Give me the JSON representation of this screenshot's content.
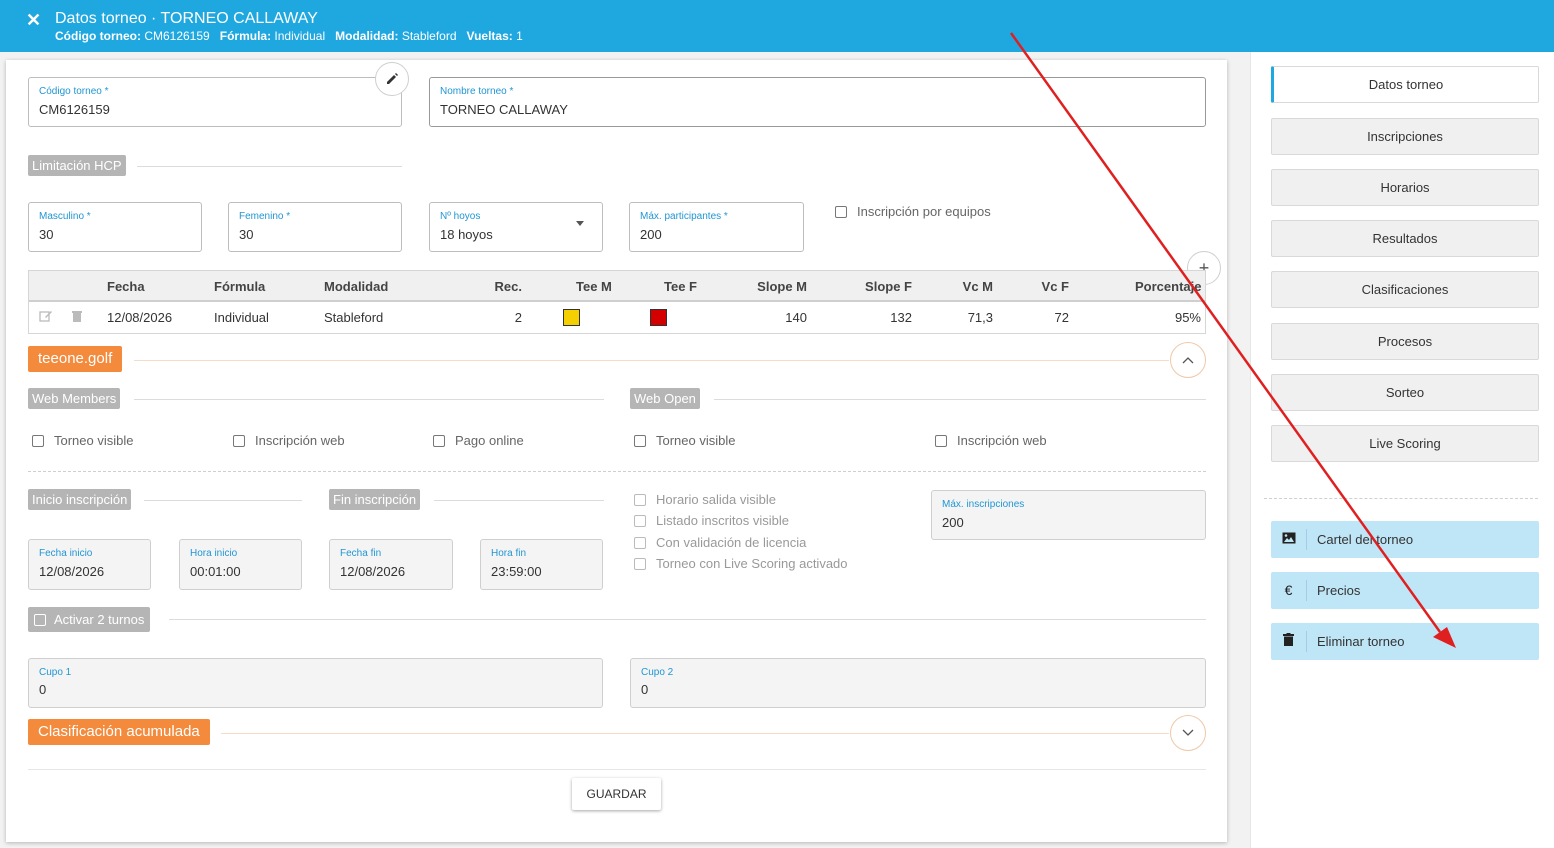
{
  "header": {
    "title": "Datos torneo · TORNEO CALLAWAY",
    "codigo_label": "Código torneo:",
    "codigo_value": "CM6126159",
    "formula_label": "Fórmula:",
    "formula_value": "Individual",
    "modalidad_label": "Modalidad:",
    "modalidad_value": "Stableford",
    "vueltas_label": "Vueltas:",
    "vueltas_value": "1",
    "close_icon": "✕"
  },
  "form": {
    "codigo": {
      "label": "Código torneo *",
      "value": "CM6126159"
    },
    "nombre": {
      "label": "Nombre torneo *",
      "value": "TORNEO CALLAWAY"
    },
    "limitacion_hcp": "Limitación HCP",
    "masculino": {
      "label": "Masculino *",
      "value": "30"
    },
    "femenino": {
      "label": "Femenino *",
      "value": "30"
    },
    "hoyos": {
      "label": "Nº hoyos",
      "value": "18 hoyos"
    },
    "max_participantes": {
      "label": "Máx. participantes *",
      "value": "200"
    },
    "inscripcion_equipos": "Inscripción por equipos"
  },
  "table": {
    "headers": [
      "Fecha",
      "Fórmula",
      "Modalidad",
      "Rec.",
      "Tee M",
      "Tee F",
      "Slope M",
      "Slope F",
      "Vc M",
      "Vc F",
      "Porcentaje"
    ],
    "row": {
      "fecha": "12/08/2026",
      "formula": "Individual",
      "modalidad": "Stableford",
      "rec": "2",
      "tee_m_color": "#f5d000",
      "tee_f_color": "#d40000",
      "slope_m": "140",
      "slope_f": "132",
      "vc_m": "71,3",
      "vc_f": "72",
      "porcentaje": "95%"
    }
  },
  "teeone": {
    "title": "teeone.golf",
    "web_members": "Web Members",
    "web_open": "Web Open",
    "members_checks": [
      "Torneo visible",
      "Inscripción web",
      "Pago online"
    ],
    "open_checks": [
      "Torneo visible",
      "Inscripción web"
    ],
    "inicio_inscripcion": "Inicio inscripción",
    "fin_inscripcion": "Fin inscripción",
    "fecha_inicio": {
      "label": "Fecha inicio",
      "value": "12/08/2026"
    },
    "hora_inicio": {
      "label": "Hora inicio",
      "value": "00:01:00"
    },
    "fecha_fin": {
      "label": "Fecha fin",
      "value": "12/08/2026"
    },
    "hora_fin": {
      "label": "Hora fin",
      "value": "23:59:00"
    },
    "open_extra_checks": [
      "Horario salida visible",
      "Listado inscritos visible",
      "Con validación de licencia",
      "Torneo con Live Scoring activado"
    ],
    "max_inscripciones": {
      "label": "Máx. inscripciones",
      "value": "200"
    },
    "activar_turnos": "Activar 2 turnos",
    "cupo1": {
      "label": "Cupo 1",
      "value": "0"
    },
    "cupo2": {
      "label": "Cupo 2",
      "value": "0"
    }
  },
  "clasificacion": {
    "title": "Clasificación acumulada"
  },
  "save_label": "GUARDAR",
  "sidebar": {
    "nav": [
      "Datos torneo",
      "Inscripciones",
      "Horarios",
      "Resultados",
      "Clasificaciones",
      "Procesos",
      "Sorteo",
      "Live Scoring"
    ],
    "actions": [
      {
        "label": "Cartel del torneo",
        "icon": "image-icon"
      },
      {
        "label": "Precios",
        "icon": "euro-icon"
      },
      {
        "label": "Eliminar torneo",
        "icon": "trash-icon"
      }
    ]
  },
  "colors": {
    "header": "#1fa7e0",
    "accent_orange": "#f38a3c",
    "action_blue": "#bfe6f7",
    "annotation_arrow": "#e02020"
  }
}
